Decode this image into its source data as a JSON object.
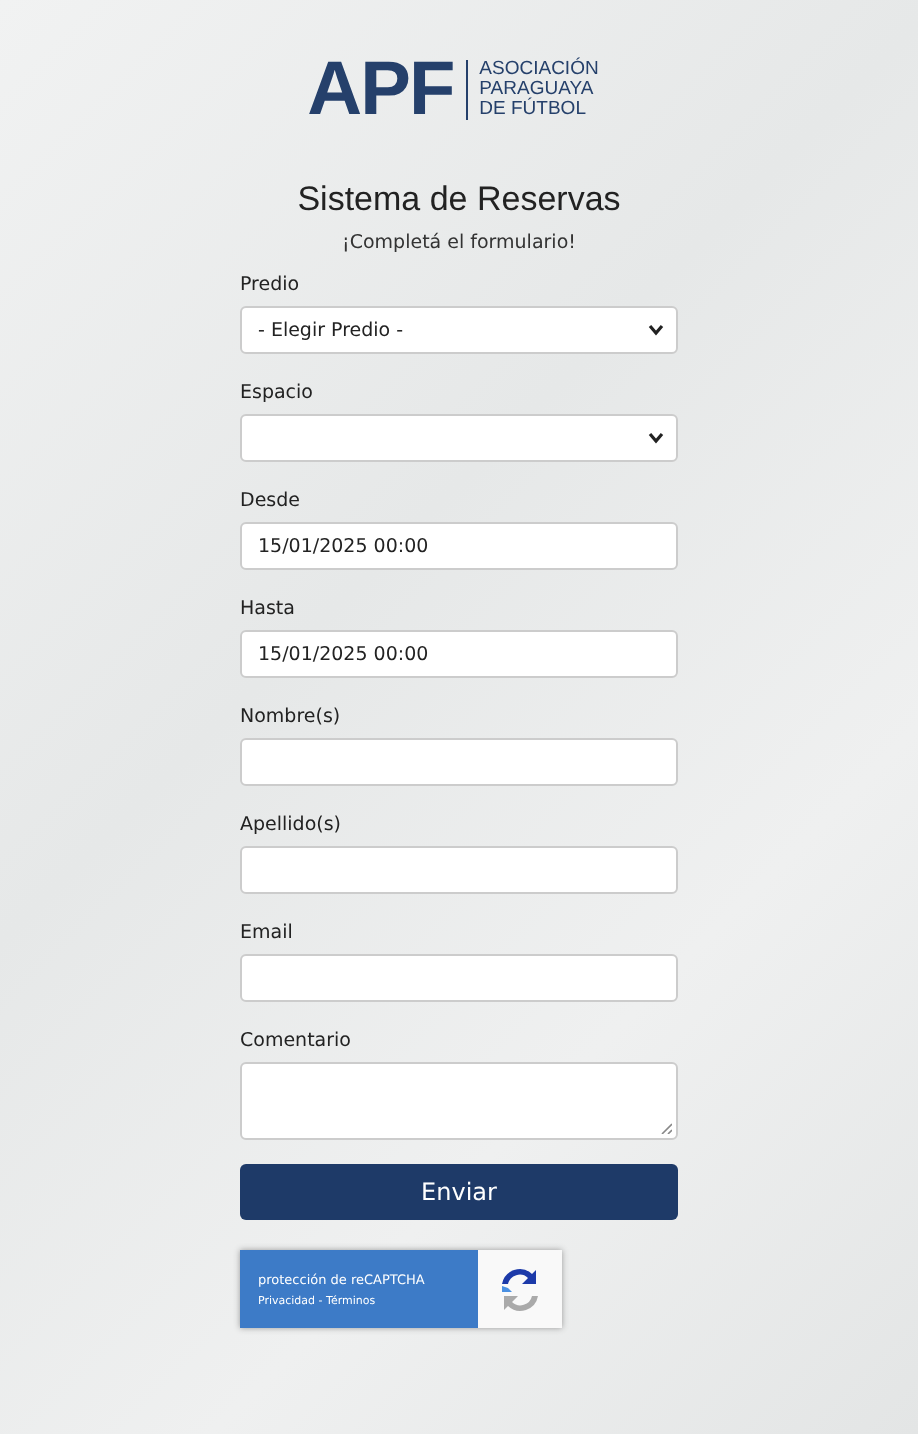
{
  "logo": {
    "mark": "APF",
    "name_lines": [
      "ASOCIACIÓN",
      "PARAGUAYA",
      "DE FÚTBOL"
    ]
  },
  "title": "Sistema de Reservas",
  "subtitle": "¡Completá el formulario!",
  "fields": [
    {
      "label": "Predio",
      "kind": "select",
      "value": "- Elegir Predio -"
    },
    {
      "label": "Espacio",
      "kind": "select"
    },
    {
      "label": "Desde",
      "kind": "input",
      "value": "15/01/2025 00:00"
    },
    {
      "label": "Hasta",
      "kind": "input",
      "value": "15/01/2025 00:00"
    },
    {
      "label": "Nombre(s)",
      "kind": "input"
    },
    {
      "label": "Apellido(s)",
      "kind": "input"
    },
    {
      "label": "Email",
      "kind": "input"
    },
    {
      "label": "Comentario",
      "kind": "textarea"
    }
  ],
  "submit": "Enviar",
  "recaptcha": {
    "text": "protección de reCAPTCHA",
    "links": "Privacidad - Términos"
  }
}
